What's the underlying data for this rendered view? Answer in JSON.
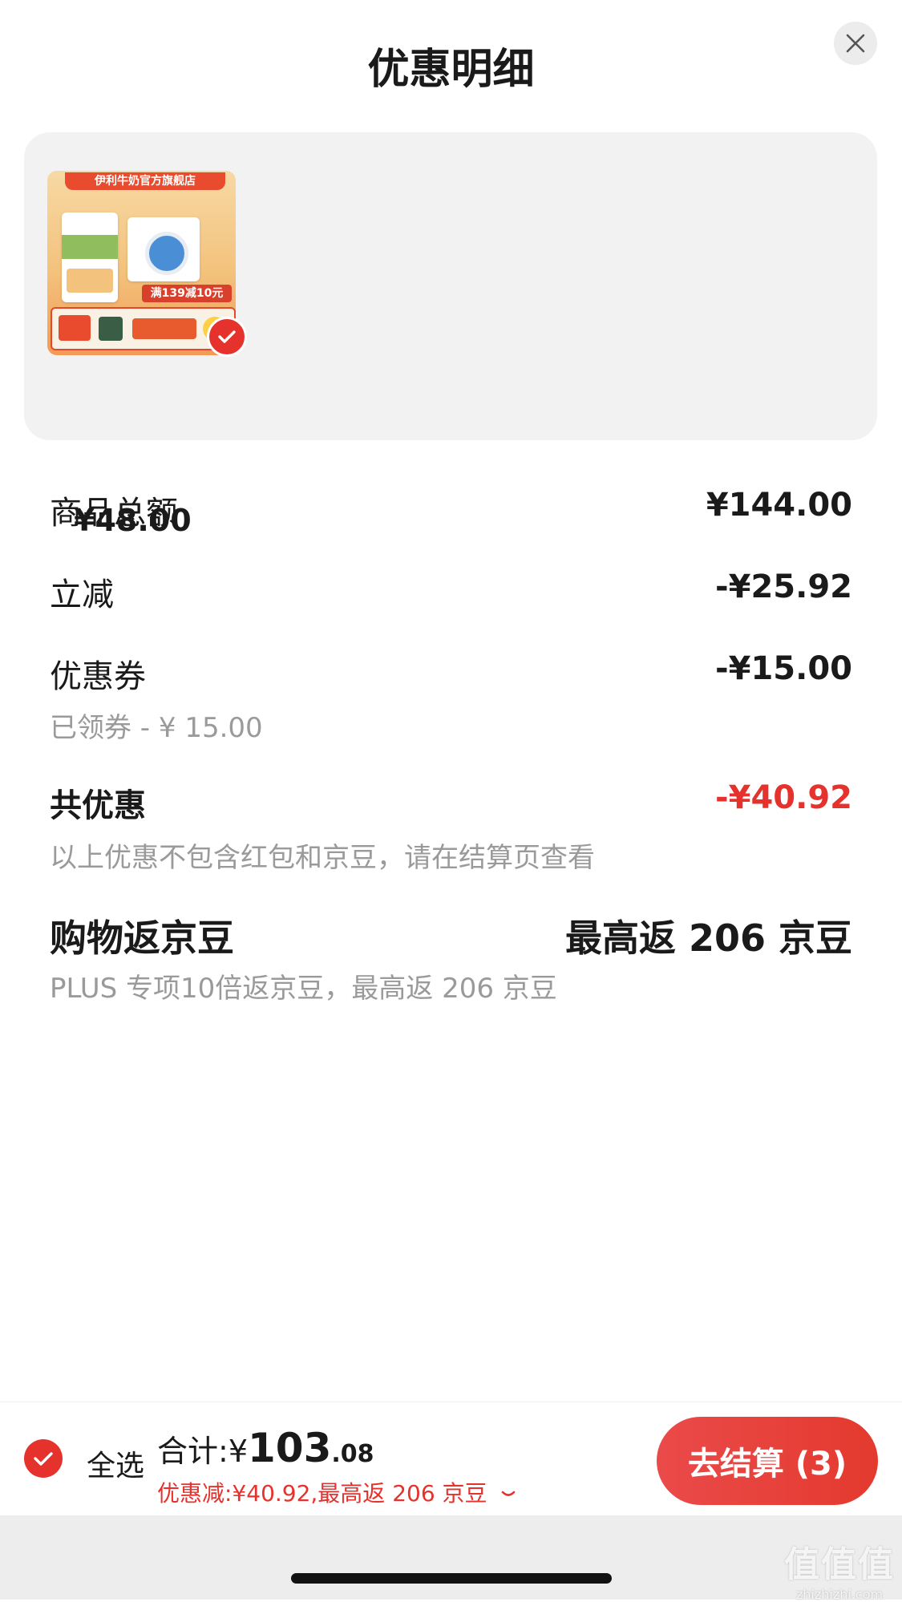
{
  "header": {
    "title": "优惠明细"
  },
  "product": {
    "store_name": "伊利牛奶官方旗舰店",
    "promo_tag": "满139减10元",
    "price": "¥48.00"
  },
  "summary": {
    "goods_total_label": "商品总额",
    "goods_total_value": "¥144.00",
    "instant_discount_label": "立减",
    "instant_discount_value": "-¥25.92",
    "coupon_label": "优惠券",
    "coupon_value": "-¥15.00",
    "coupon_sub": "已领券 - ¥ 15.00",
    "total_discount_label": "共优惠",
    "total_discount_value": "-¥40.92",
    "total_discount_note": "以上优惠不包含红包和京豆，请在结算页查看",
    "beans_label": "购物返京豆",
    "beans_value": "最高返 206 京豆",
    "beans_note": "PLUS 专项10倍返京豆，最高返 206 京豆"
  },
  "footer": {
    "select_all_label": "全选",
    "total_label": "合计:",
    "total_currency": "¥",
    "total_integer": "103",
    "total_decimal": ".08",
    "discount_line": "优惠减:¥40.92,最高返 206 京豆",
    "checkout_label": "去结算 (3)"
  },
  "watermark": {
    "glyphs": "值值值",
    "url": "zhizhizhi.com"
  },
  "colors": {
    "accent": "#e5322d",
    "card_bg": "#f2f2f2",
    "muted_text": "#9a9a9a"
  }
}
